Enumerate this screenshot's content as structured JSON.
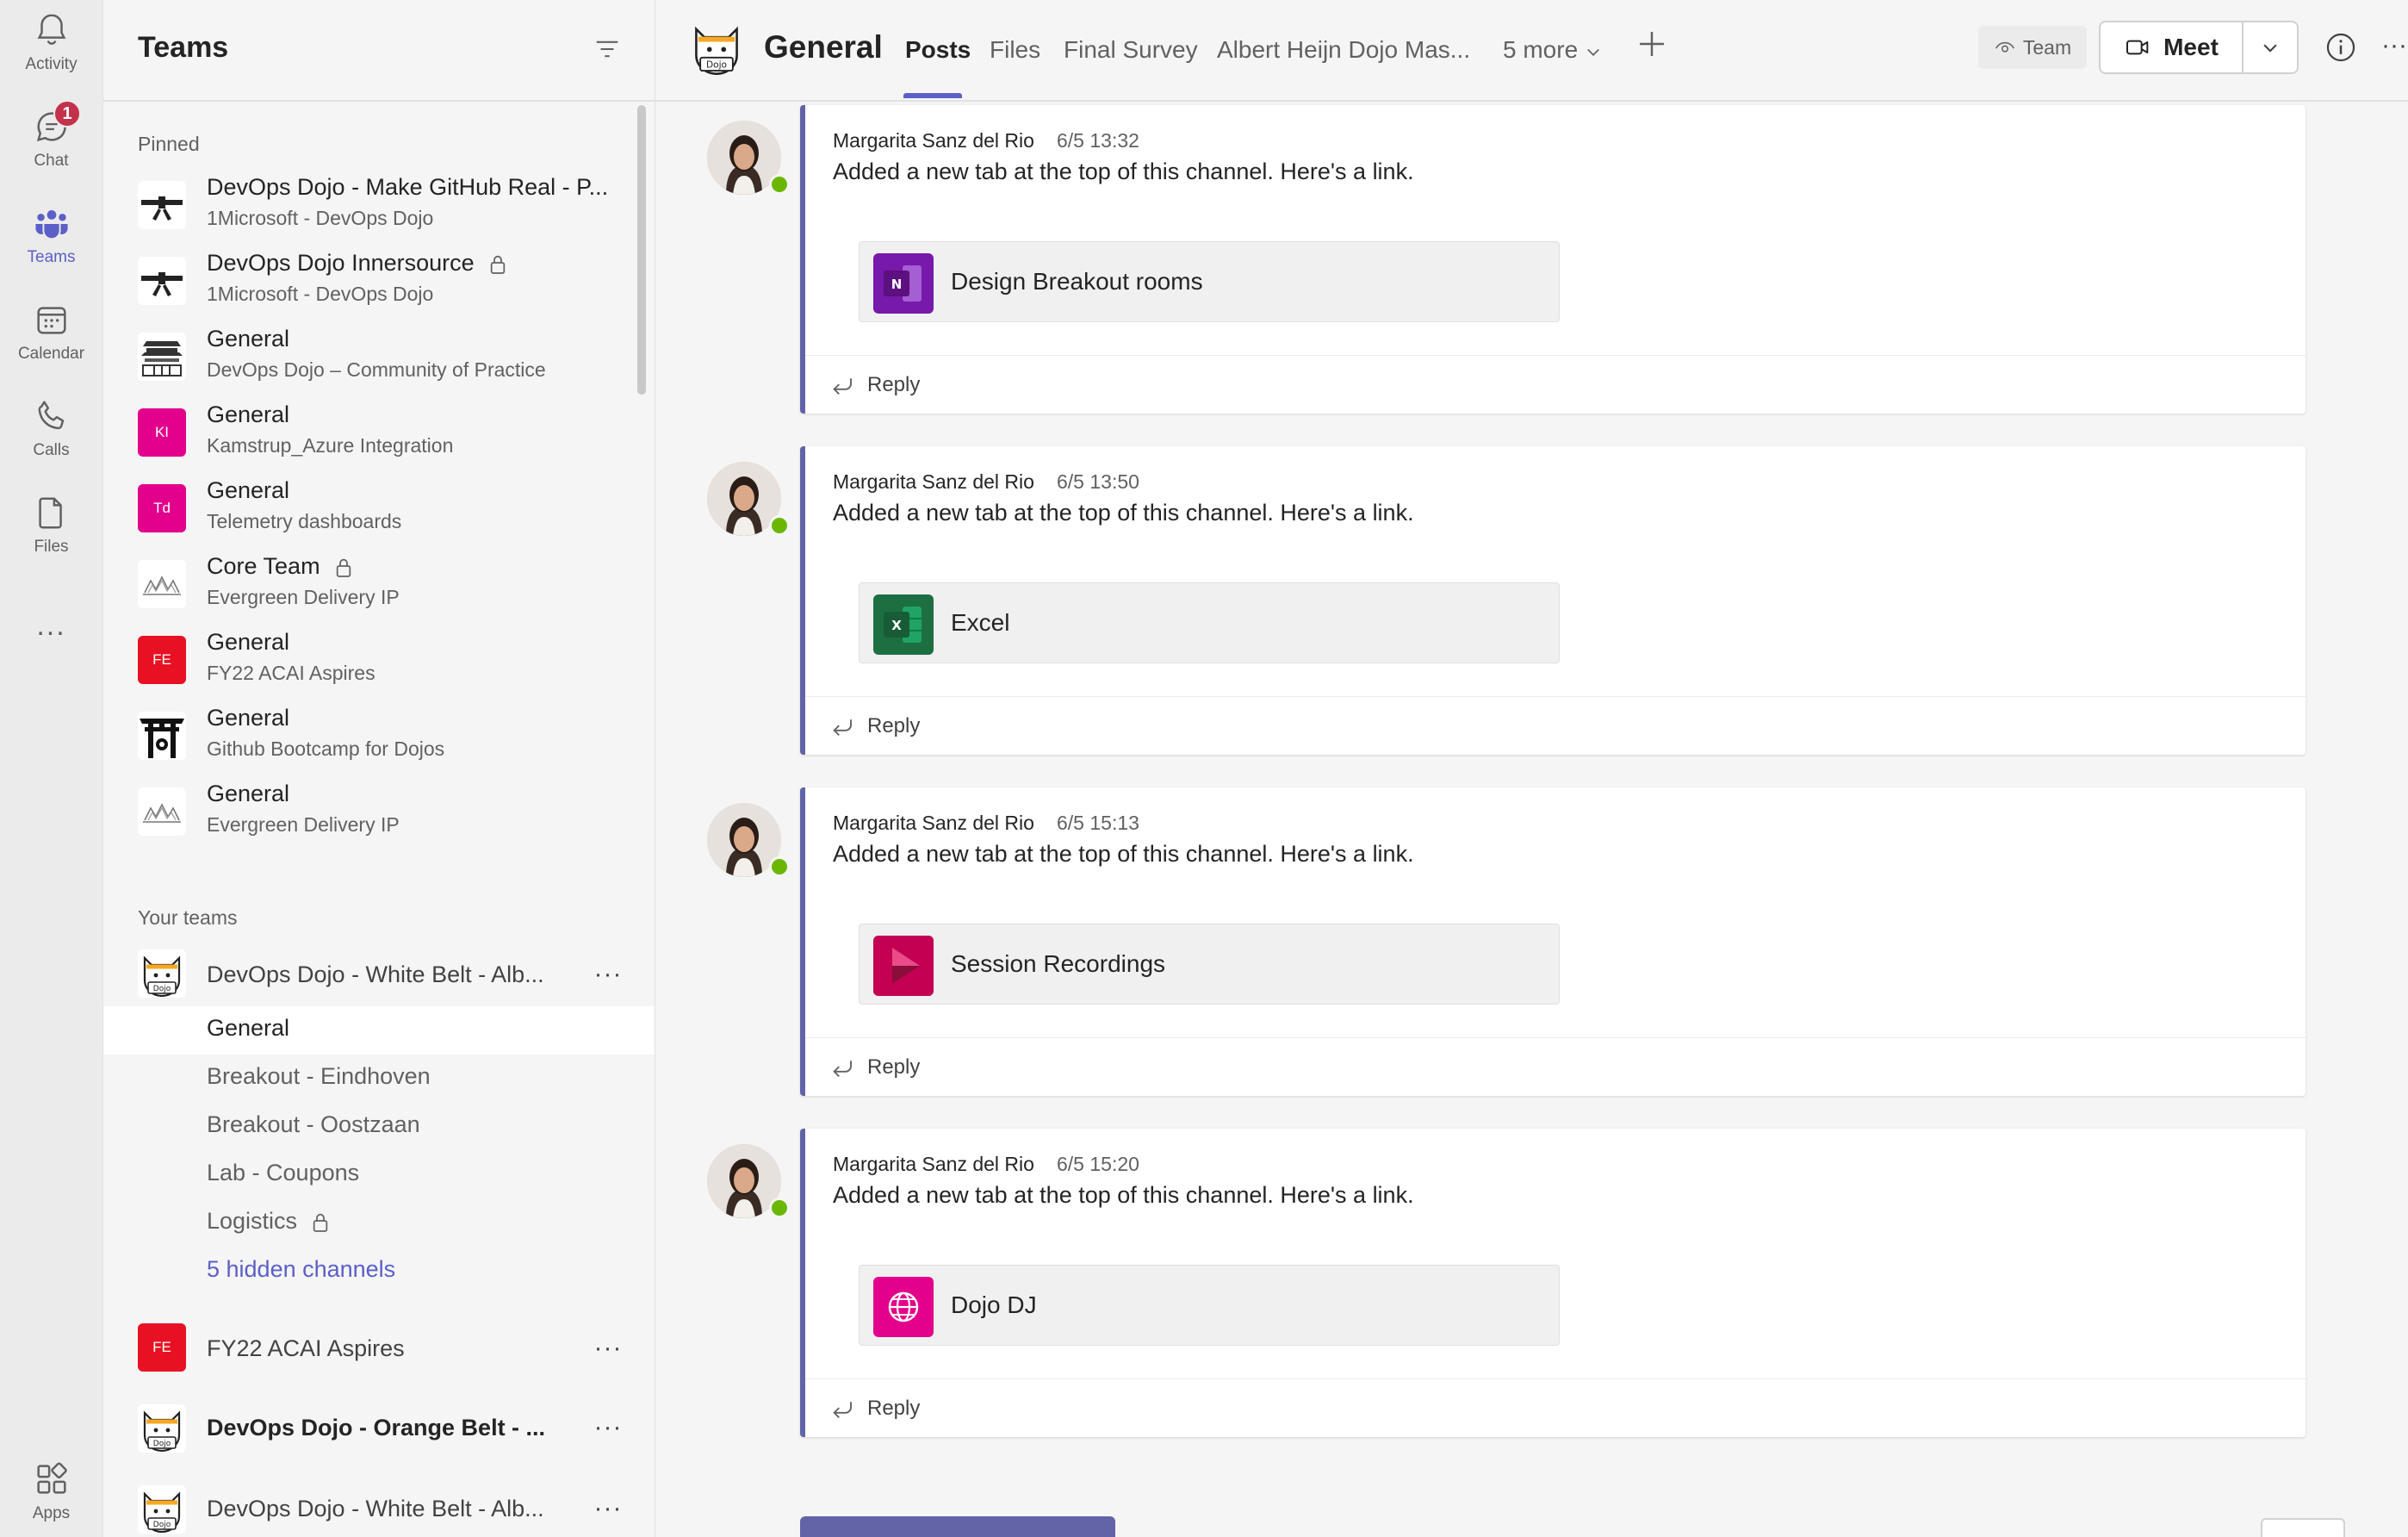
{
  "rail": {
    "items": [
      {
        "label": "Activity",
        "icon": "bell-icon"
      },
      {
        "label": "Chat",
        "icon": "chat-icon",
        "badge": "1"
      },
      {
        "label": "Teams",
        "icon": "teams-icon",
        "active": true
      },
      {
        "label": "Calendar",
        "icon": "calendar-icon"
      },
      {
        "label": "Calls",
        "icon": "phone-icon"
      },
      {
        "label": "Files",
        "icon": "file-icon"
      },
      {
        "label": "Apps",
        "icon": "apps-icon"
      }
    ],
    "more": "..."
  },
  "teams_pane": {
    "title": "Teams",
    "pinned_label": "Pinned",
    "pinned": [
      {
        "title": "DevOps Dojo - Make GitHub Real - P...",
        "subtitle": "1Microsoft - DevOps Dojo",
        "avatar": "belt"
      },
      {
        "title": "DevOps Dojo Innersource",
        "subtitle": "1Microsoft - DevOps Dojo",
        "avatar": "belt",
        "locked": true
      },
      {
        "title": "General",
        "subtitle": "DevOps Dojo – Community of Practice",
        "avatar": "dojo-building"
      },
      {
        "title": "General",
        "subtitle": "Kamstrup_Azure Integration",
        "avatar_initials": "KI",
        "avatar_color": "#e3008c"
      },
      {
        "title": "General",
        "subtitle": "Telemetry dashboards",
        "avatar_initials": "Td",
        "avatar_color": "#e3008c"
      },
      {
        "title": "Core Team",
        "subtitle": "Evergreen Delivery IP",
        "avatar": "mountains",
        "locked": true
      },
      {
        "title": "General",
        "subtitle": "FY22 ACAI Aspires",
        "avatar_initials": "FE",
        "avatar_color": "#e81123"
      },
      {
        "title": "General",
        "subtitle": "Github Bootcamp for Dojos",
        "avatar": "torii"
      },
      {
        "title": "General",
        "subtitle": "Evergreen Delivery IP",
        "avatar": "mountains"
      }
    ],
    "your_teams_label": "Your teams",
    "team1": {
      "name": "DevOps Dojo - White Belt - Alb...",
      "channels": [
        {
          "name": "General",
          "selected": true
        },
        {
          "name": "Breakout - Eindhoven"
        },
        {
          "name": "Breakout - Oostzaan"
        },
        {
          "name": "Lab - Coupons"
        },
        {
          "name": "Logistics",
          "locked": true
        }
      ],
      "hidden_channels": "5 hidden channels"
    },
    "team2": {
      "name": "FY22 ACAI Aspires",
      "avatar_initials": "FE",
      "avatar_color": "#e81123"
    },
    "team3": {
      "name": "DevOps Dojo - Orange Belt - ...",
      "bold": true
    },
    "team4": {
      "name": "DevOps Dojo - White Belt - Alb..."
    },
    "more": "···"
  },
  "header": {
    "channel_title": "General",
    "avatar_text": "Dojo",
    "tabs": [
      "Posts",
      "Files",
      "Final Survey",
      "Albert Heijn Dojo Mas...",
      "5 more"
    ],
    "team_badge": "Team",
    "meet_label": "Meet",
    "more": "···"
  },
  "posts": [
    {
      "author": "Margarita Sanz del Rio",
      "time": "6/5 13:32",
      "text": "Added a new tab at the top of this channel. Here's a link.",
      "tab_name": "Design Breakout rooms",
      "tab_icon": "onenote-icon",
      "tab_icon_letter": "N",
      "tab_color": "#7719aa",
      "reply": "Reply"
    },
    {
      "author": "Margarita Sanz del Rio",
      "time": "6/5 13:50",
      "text": "Added a new tab at the top of this channel. Here's a link.",
      "tab_name": "Excel",
      "tab_icon": "excel-icon",
      "tab_icon_letter": "X",
      "tab_color": "#1d6f42",
      "reply": "Reply"
    },
    {
      "author": "Margarita Sanz del Rio",
      "time": "6/5 15:13",
      "text": "Added a new tab at the top of this channel. Here's a link.",
      "tab_name": "Session Recordings",
      "tab_icon": "stream-icon",
      "tab_color": "#bc1948",
      "reply": "Reply"
    },
    {
      "author": "Margarita Sanz del Rio",
      "time": "6/5 15:20",
      "text": "Added a new tab at the top of this channel. Here's a link.",
      "tab_name": "Dojo DJ",
      "tab_icon": "globe-icon",
      "tab_color": "#e3008c",
      "reply": "Reply"
    }
  ],
  "colors": {
    "brand": "#5b5fc7",
    "post_accent": "#6264a7",
    "presence": "#6bb700",
    "badge": "#c4314b"
  }
}
